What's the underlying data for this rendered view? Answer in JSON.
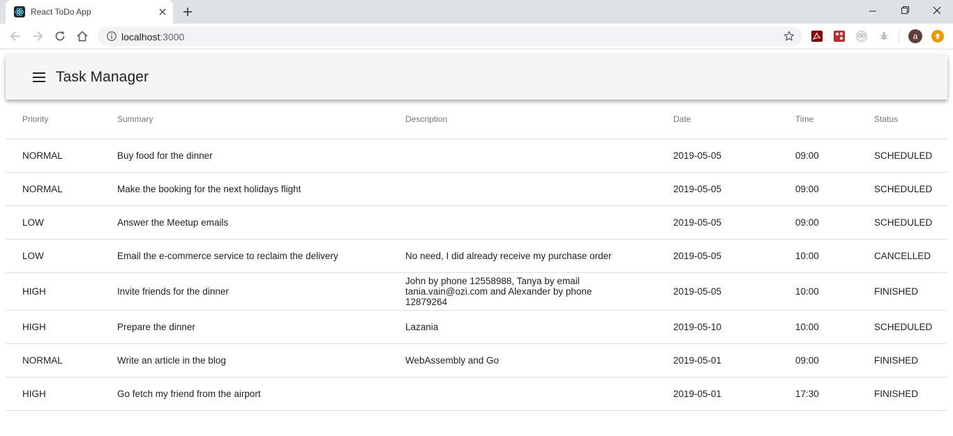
{
  "browser": {
    "tab_title": "React ToDo App",
    "url_host": "localhost",
    "url_port": ":3000",
    "profile_initial": "a"
  },
  "app": {
    "title": "Task Manager"
  },
  "table": {
    "headers": {
      "priority": "Priority",
      "summary": "Summary",
      "description": "Description",
      "date": "Date",
      "time": "Time",
      "status": "Status"
    },
    "rows": [
      {
        "priority": "NORMAL",
        "summary": "Buy food for the dinner",
        "description": "",
        "date": "2019-05-05",
        "time": "09:00",
        "status": "SCHEDULED"
      },
      {
        "priority": "NORMAL",
        "summary": "Make the booking for the next holidays flight",
        "description": "",
        "date": "2019-05-05",
        "time": "09:00",
        "status": "SCHEDULED"
      },
      {
        "priority": "LOW",
        "summary": "Answer the Meetup emails",
        "description": "",
        "date": "2019-05-05",
        "time": "09:00",
        "status": "SCHEDULED"
      },
      {
        "priority": "LOW",
        "summary": "Email the e-commerce service to reclaim the delivery",
        "description": "No need, I did already receive my purchase order",
        "date": "2019-05-05",
        "time": "10:00",
        "status": "CANCELLED"
      },
      {
        "priority": "HIGH",
        "summary": "Invite friends for the dinner",
        "description": "John by phone 12558988, Tanya by email tania.vain@ozi.com and Alexander by phone 12879264",
        "date": "2019-05-05",
        "time": "10:00",
        "status": "FINISHED"
      },
      {
        "priority": "HIGH",
        "summary": "Prepare the dinner",
        "description": "Lazania",
        "date": "2019-05-10",
        "time": "10:00",
        "status": "SCHEDULED"
      },
      {
        "priority": "NORMAL",
        "summary": "Write an article in the blog",
        "description": "WebAssembly and Go",
        "date": "2019-05-01",
        "time": "09:00",
        "status": "FINISHED"
      },
      {
        "priority": "HIGH",
        "summary": "Go fetch my friend from the airport",
        "description": "",
        "date": "2019-05-01",
        "time": "17:30",
        "status": "FINISHED"
      }
    ]
  },
  "icons": {
    "tab_favicon": "react-logo-icon",
    "tab_close": "close-icon",
    "new_tab": "plus-icon",
    "back": "arrow-left-icon",
    "forward": "arrow-right-icon",
    "reload": "reload-icon",
    "home": "home-icon",
    "site_info": "info-icon",
    "bookmark": "star-icon",
    "menu": "hamburger-menu-icon"
  },
  "colors": {
    "appbar_bg": "#f5f5f5",
    "tabstrip_bg": "#dee1e6",
    "avatar_bg": "#5d4037",
    "update_badge": "#f29900",
    "divider": "#e0e0e0"
  }
}
